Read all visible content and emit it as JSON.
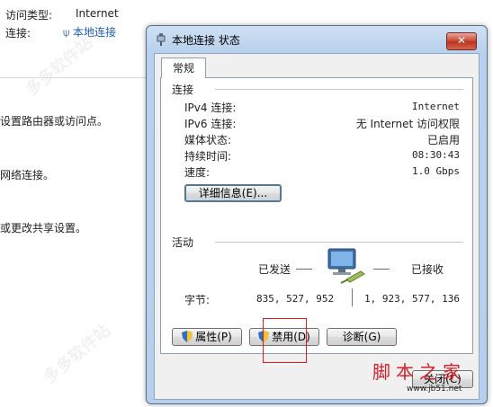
{
  "background": {
    "access_type_label": "访问类型:",
    "access_type_value": "Internet",
    "connection_label": "连接:",
    "connection_link": "本地连接",
    "text_1": "设置路由器或访问点。",
    "text_2": "网络连接。",
    "text_3": "或更改共享设置。"
  },
  "dialog": {
    "title": "本地连接 状态",
    "close_label": "✕",
    "tab_general": "常规",
    "connection": {
      "group_title": "连接",
      "rows": [
        {
          "label": "IPv4 连接:",
          "value": "Internet"
        },
        {
          "label": "IPv6 连接:",
          "value": "无 Internet 访问权限"
        },
        {
          "label": "媒体状态:",
          "value": "已启用"
        },
        {
          "label": "持续时间:",
          "value": "08:30:43"
        },
        {
          "label": "速度:",
          "value": "1.0 Gbps"
        }
      ],
      "details_button": "详细信息(E)..."
    },
    "activity": {
      "group_title": "活动",
      "sent_label": "已发送",
      "received_label": "已接收",
      "bytes_label": "字节:",
      "bytes_sent": "835, 527, 952",
      "bytes_received": "1, 923, 577, 136"
    },
    "buttons": {
      "properties": "属性(P)",
      "disable": "禁用(D)",
      "diagnose": "诊断(G)",
      "close": "关闭(C)"
    }
  },
  "watermark": {
    "brand": "脚本之家",
    "url": "www.jb51.net",
    "faint_text": "多多软件站"
  },
  "colors": {
    "highlight": "#e3191b",
    "brand_red": "#d4202a",
    "link_blue": "#1a5fb4"
  }
}
